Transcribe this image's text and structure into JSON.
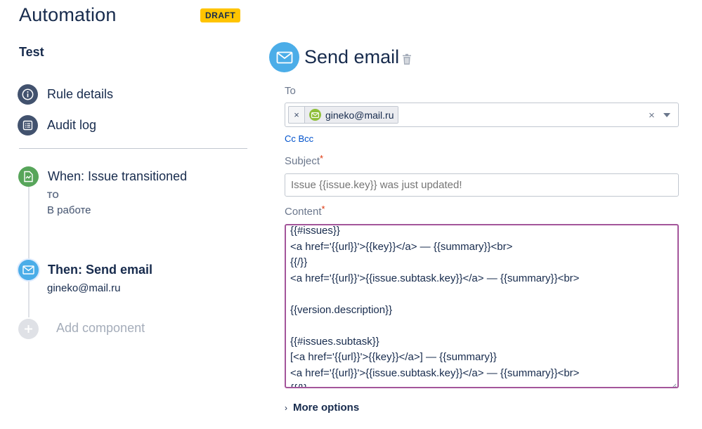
{
  "header": {
    "title": "Automation",
    "badge": "DRAFT"
  },
  "sidebar": {
    "rule_name": "Test",
    "nav": [
      {
        "label": "Rule details",
        "icon": "info-icon"
      },
      {
        "label": "Audit log",
        "icon": "list-icon"
      }
    ],
    "trigger": {
      "title": "When: Issue transitioned",
      "to_label": "TO",
      "status": "В работе",
      "icon": "issue-transition-icon",
      "color": "#57a55a"
    },
    "action": {
      "title": "Then: Send email",
      "subtitle": "gineko@mail.ru",
      "icon": "envelope-icon",
      "color": "#4bade8"
    },
    "add_component": {
      "label": "Add component",
      "icon": "plus-icon"
    }
  },
  "main": {
    "title": "Send email",
    "icon": "envelope-icon",
    "to": {
      "label": "To",
      "chips": [
        {
          "remove": "×",
          "email": "gineko@mail.ru"
        }
      ],
      "clear": "×"
    },
    "cc_bcc": "Cc Bcc",
    "subject": {
      "label": "Subject",
      "required_mark": "*",
      "placeholder": "Issue {{issue.key}} was just updated!"
    },
    "content": {
      "label": "Content",
      "required_mark": "*",
      "lines": [
        "{{#issues}}",
        "<a href='{{url}}'>{{key}}</a> — {{summary}}<br>",
        "{{/}}",
        "<a href='{{url}}'>{{issue.subtask.key}}</a> — {{summary}}<br>",
        "",
        "{{version.description}}",
        "",
        "{{#issues.subtask}}",
        "[<a href='{{url}}'>{{key}}</a>] — {{summary}}",
        "<a href='{{url}}'>{{issue.subtask.key}}</a> — {{summary}}<br>",
        "{{/}}"
      ]
    },
    "more_options": "More options"
  },
  "colors": {
    "accent": "#4bade8",
    "badge": "#ffc400",
    "focus_border": "#a3559a",
    "link": "#0052cc",
    "required": "#de350b"
  }
}
